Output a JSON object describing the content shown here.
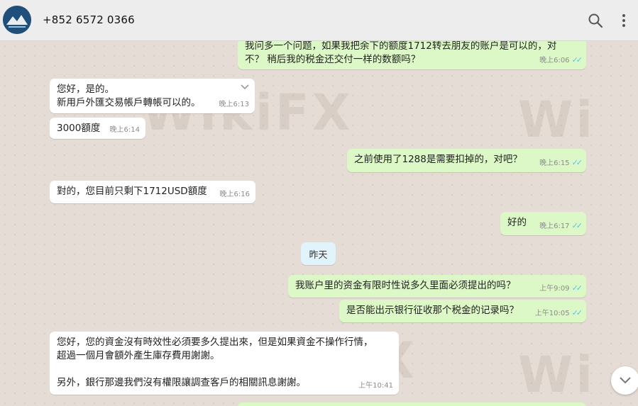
{
  "header": {
    "contact_name": "+852 6572 0366"
  },
  "icons": {
    "avatar": "avatar-logo-icon",
    "search": "search-icon",
    "menu": "more-vert-icon",
    "scroll_down": "chevron-down-icon"
  },
  "colors": {
    "incoming_bubble": "#ffffff",
    "outgoing_bubble": "#dcf8c6",
    "read_ticks": "#4fc3f7",
    "date_chip": "#e1f3fb",
    "chat_background": "#e5ddd5"
  },
  "watermark": "WikiFX",
  "messages": [
    {
      "dir": "out",
      "text": "我问多一个问题，如果我把余下的额度1712转去朋友的账户是可以的，对\n不？ 稍后我的税金还交付一样的数额吗？",
      "time": "晚上6:06",
      "ticks": "✓✓"
    },
    {
      "dir": "in",
      "text": "您好，是的。\n新用戶外匯交易帳戶轉帳可以的。",
      "time": "晚上6:13"
    },
    {
      "dir": "in",
      "text": "3000額度",
      "time": "晚上6:14"
    },
    {
      "dir": "out",
      "text": "之前使用了1288是需要扣掉的，对吧？",
      "time": "晚上6:15",
      "ticks": "✓✓"
    },
    {
      "dir": "in",
      "text": "對的，您目前只剩下1712USD額度",
      "time": "晚上6:16"
    },
    {
      "dir": "out",
      "text": "好的",
      "time": "晚上6:17",
      "ticks": "✓✓"
    },
    {
      "dir": "out",
      "text": "我账户里的资金有限时性说多久里面必须提出的吗？",
      "time": "上午9:09",
      "ticks": "✓✓"
    },
    {
      "dir": "out",
      "text": "是否能出示银行征收那个税金的记录吗？",
      "time": "上午10:05",
      "ticks": "✓✓"
    },
    {
      "dir": "in",
      "text": "您好，您的資金沒有時效性必須要多久提出來，但是如果資金不操作行情，\n超過一個月會額外產生庫存費用謝謝。\n\n另外，銀行那邊我們沒有權限讓調查客戶的相關訊息謝謝。",
      "time": "上午10:41"
    }
  ],
  "date_separator": "昨天"
}
